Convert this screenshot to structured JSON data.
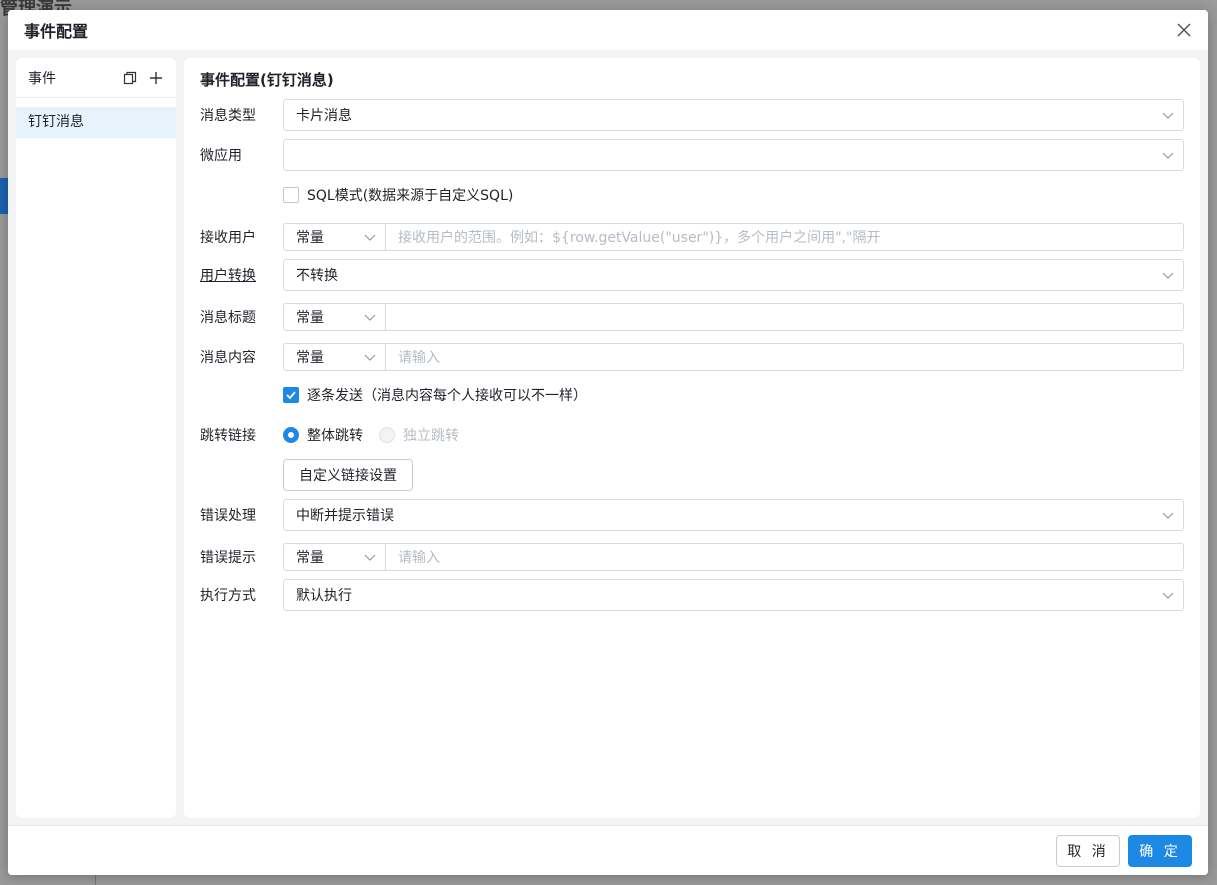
{
  "background": {
    "app_title": "管理演示"
  },
  "dialog": {
    "title": "事件配置",
    "close_icon": "close-icon"
  },
  "events_panel": {
    "header": "事件",
    "items": [
      {
        "label": "钉钉消息",
        "selected": true
      }
    ]
  },
  "config": {
    "title": "事件配置(钉钉消息)",
    "message_type": {
      "label": "消息类型",
      "value": "卡片消息"
    },
    "micro_app": {
      "label": "微应用",
      "value": ""
    },
    "sql_mode": {
      "label": "SQL模式(数据来源于自定义SQL)",
      "checked": false
    },
    "receiver": {
      "label": "接收用户",
      "mode": "常量",
      "placeholder": "接收用户的范围。例如：${row.getValue(\"user\")}，多个用户之间用\",\"隔开"
    },
    "user_convert": {
      "label": "用户转换",
      "value": "不转换"
    },
    "msg_title": {
      "label": "消息标题",
      "mode": "常量",
      "placeholder": ""
    },
    "msg_content": {
      "label": "消息内容",
      "mode": "常量",
      "placeholder": "请输入"
    },
    "send_each": {
      "label": "逐条发送（消息内容每个人接收可以不一样）",
      "checked": true
    },
    "jump_link": {
      "label": "跳转链接",
      "options": [
        {
          "label": "整体跳转",
          "checked": true,
          "disabled": false
        },
        {
          "label": "独立跳转",
          "checked": false,
          "disabled": true
        }
      ],
      "custom_button": "自定义链接设置"
    },
    "error_handling": {
      "label": "错误处理",
      "value": "中断并提示错误"
    },
    "error_tip": {
      "label": "错误提示",
      "mode": "常量",
      "placeholder": "请输入"
    },
    "exec_mode": {
      "label": "执行方式",
      "value": "默认执行"
    }
  },
  "footer": {
    "cancel": "取 消",
    "ok": "确 定"
  },
  "colors": {
    "primary": "#1e88e5",
    "selected_item_bg": "#e6f3fd"
  }
}
